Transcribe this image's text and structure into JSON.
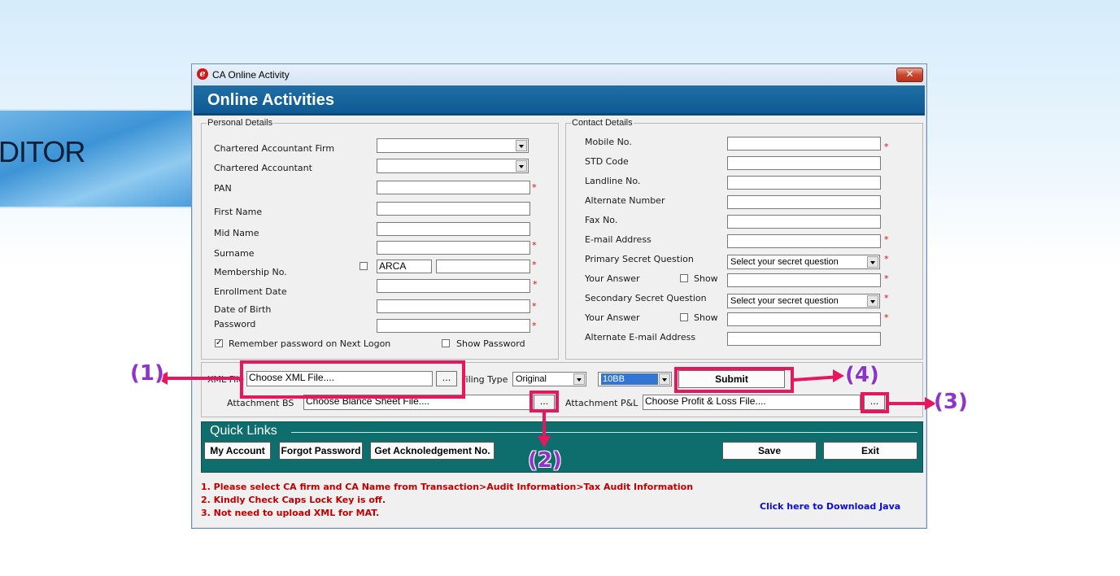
{
  "background": {
    "brand_text": "DITOR"
  },
  "window": {
    "title": "CA Online Activity",
    "close_symbol": "✕",
    "header_title": "Online Activities"
  },
  "personal": {
    "legend": "Personal Details",
    "ca_firm_label": "Chartered Accountant Firm",
    "ca_label": "Chartered Accountant",
    "pan_label": "PAN",
    "first_name_label": "First Name",
    "mid_name_label": "Mid Name",
    "surname_label": "Surname",
    "membership_label": "Membership No.",
    "membership_prefix": "ARCA",
    "enrollment_label": "Enrollment Date",
    "dob_label": "Date of Birth",
    "password_label": "Password",
    "remember_label": "Remember password on Next Logon",
    "show_password_label": "Show Password"
  },
  "contact": {
    "legend": "Contact Details",
    "mobile_label": "Mobile No.",
    "std_label": "STD Code",
    "landline_label": "Landline No.",
    "alternate_label": "Alternate Number",
    "fax_label": "Fax No.",
    "email_label": "E-mail Address",
    "primary_q_label": "Primary Secret Question",
    "primary_q_value": "Select your secret question",
    "answer_label": "Your Answer",
    "show_label": "Show",
    "secondary_q_label": "Secondary Secret Question",
    "secondary_q_value": "Select your secret question",
    "alt_email_label": "Alternate E-mail Address"
  },
  "upload": {
    "xml_label": "XML File",
    "xml_placeholder": "Choose XML File....",
    "browse_label": "...",
    "filing_type_label": "Filing Type",
    "filing_type_value": "Original",
    "form_value": "10BB",
    "submit_label": "Submit",
    "attach_bs_label": "Attachment BS",
    "attach_bs_placeholder": "Choose Blance Sheet File....",
    "attach_pl_label": "Attachment P&L",
    "attach_pl_placeholder": "Choose Profit & Loss File...."
  },
  "quick_links": {
    "title": "Quick Links",
    "my_account": "My Account",
    "forgot_password": "Forgot Password",
    "ack_no": "Get Acknoledgement No.",
    "save": "Save",
    "exit": "Exit"
  },
  "notes": [
    "1. Please select CA firm and CA Name from Transaction>Audit Information>Tax Audit Information",
    "2. Kindly Check Caps Lock Key is off.",
    "3. Not need to upload XML for MAT."
  ],
  "java_link": "Click here to Download Java",
  "required_mark": "*",
  "annotations": {
    "c1": "(1)",
    "c2": "(2)",
    "c3": "(3)",
    "c4": "(4)"
  },
  "colors": {
    "header": "#105a93",
    "quick_links": "#0e6d6d",
    "annotation": "#e8175d",
    "callout": "#8e34c9",
    "notes": "#c00000"
  }
}
